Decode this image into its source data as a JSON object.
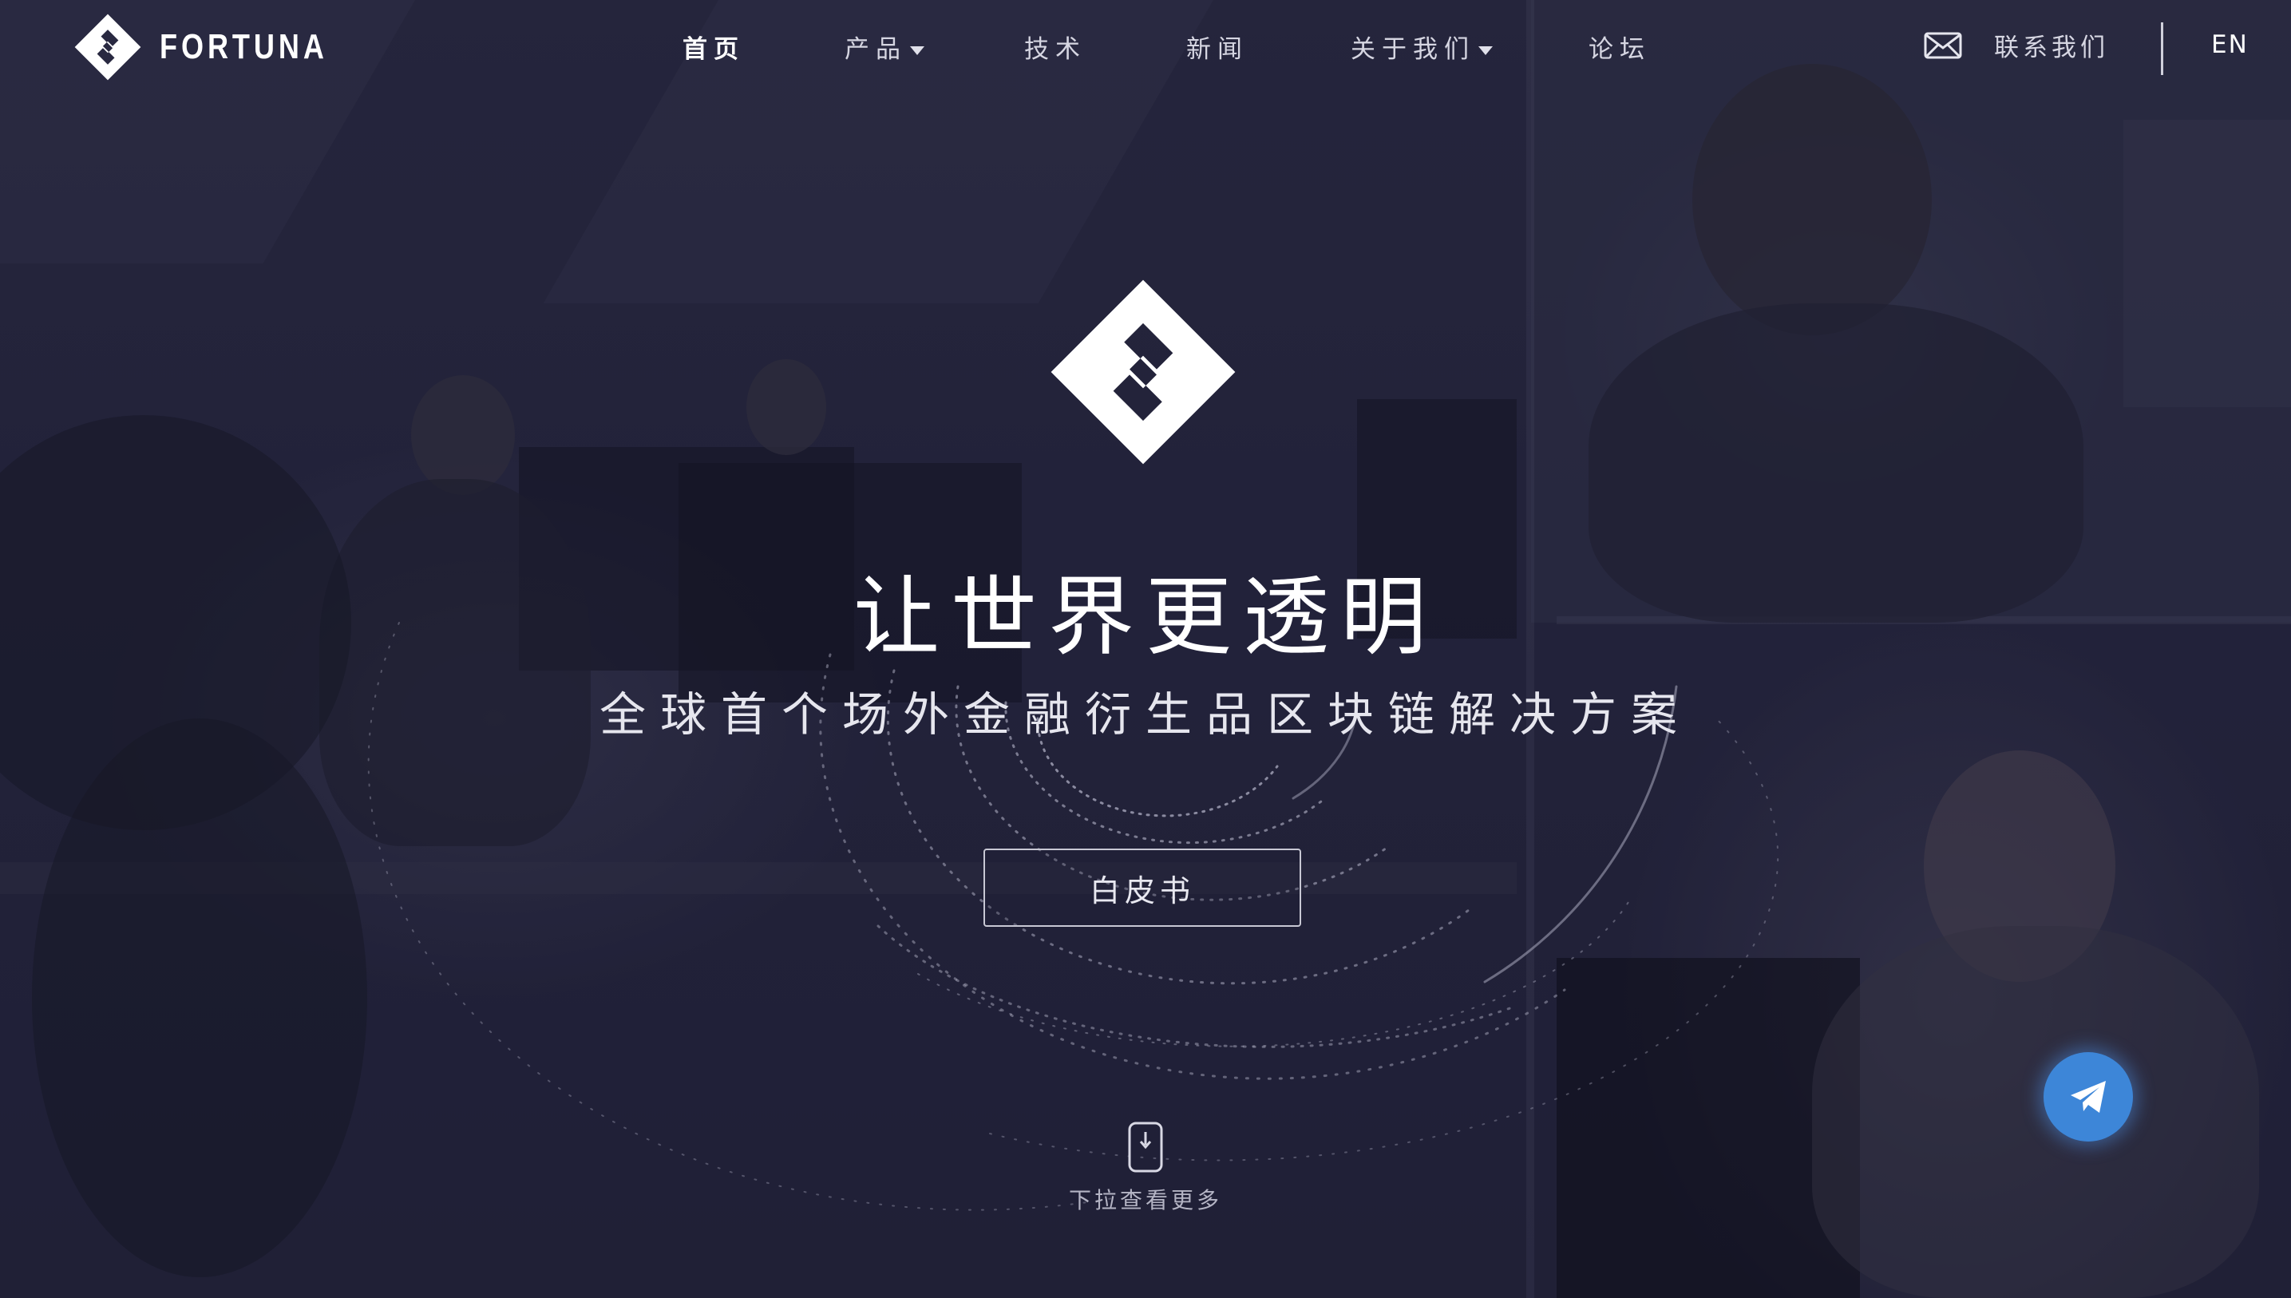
{
  "brand": {
    "name": "FORTUNA",
    "logo_icon": "fortuna-logo-icon"
  },
  "nav": {
    "items": [
      {
        "label": "首页",
        "active": true,
        "dropdown": false
      },
      {
        "label": "产品",
        "active": false,
        "dropdown": true
      },
      {
        "label": "技术",
        "active": false,
        "dropdown": false
      },
      {
        "label": "新闻",
        "active": false,
        "dropdown": false
      },
      {
        "label": "关于我们",
        "active": false,
        "dropdown": true
      },
      {
        "label": "论坛",
        "active": false,
        "dropdown": false
      }
    ],
    "contact_label": "联系我们",
    "contact_icon": "mail-icon",
    "language": "EN"
  },
  "hero": {
    "title": "让世界更透明",
    "subtitle": "全球首个场外金融衍生品区块链解决方案",
    "cta_label": "白皮书",
    "scroll_label": "下拉查看更多",
    "scroll_icon": "mouse-scroll-icon"
  },
  "floating": {
    "icon": "telegram-icon",
    "color": "#3d86d8"
  },
  "colors": {
    "background": "#23233a",
    "text": "#ffffff",
    "telegram": "#3d86d8"
  }
}
